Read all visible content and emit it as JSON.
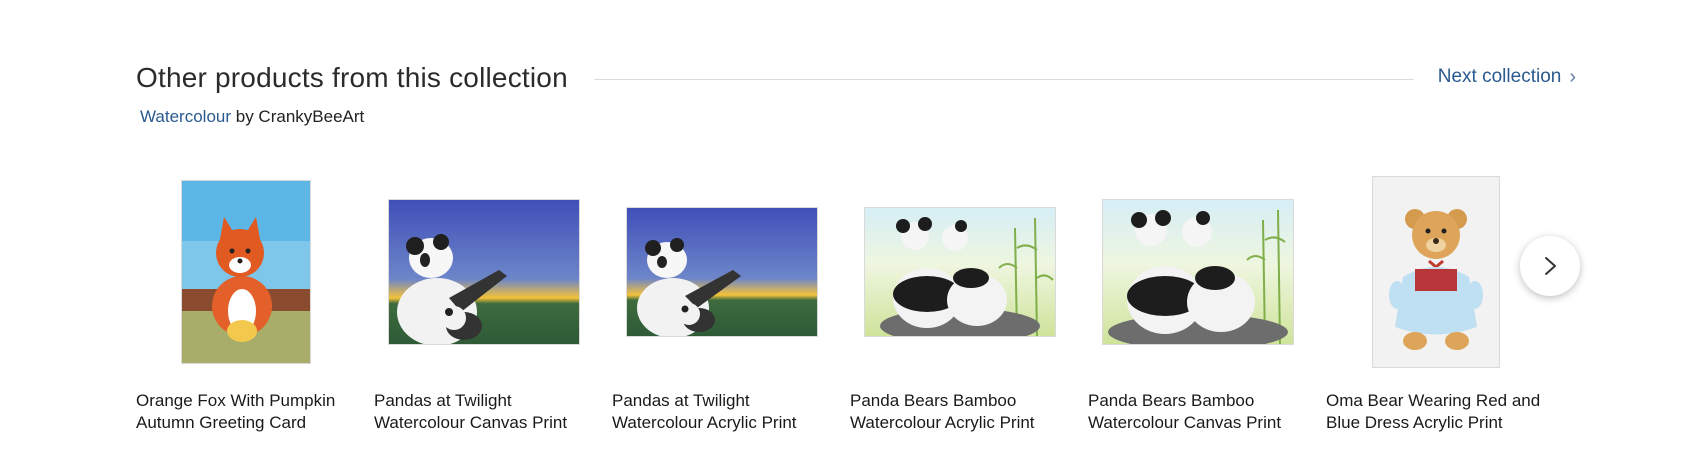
{
  "section": {
    "title": "Other products from this collection",
    "next_label": "Next collection",
    "collection_name": "Watercolour",
    "by_text": "by CrankyBeeArt"
  },
  "products": [
    {
      "line1": "Orange Fox With Pumpkin",
      "line2": "Autumn Greeting Card"
    },
    {
      "line1": "Pandas at Twilight",
      "line2": "Watercolour Canvas Print"
    },
    {
      "line1": "Pandas at Twilight",
      "line2": "Watercolour Acrylic Print"
    },
    {
      "line1": "Panda Bears Bamboo",
      "line2": "Watercolour Acrylic Print"
    },
    {
      "line1": "Panda Bears Bamboo",
      "line2": "Watercolour Canvas Print"
    },
    {
      "line1": "Oma Bear Wearing Red and",
      "line2": "Blue Dress Acrylic Print"
    }
  ],
  "icons": {
    "next_collection": "chevron-right-icon",
    "carousel_next": "arrow-right-icon"
  },
  "colors": {
    "link": "#2a5a8f",
    "text": "#222222",
    "rule": "#dcdcdc"
  }
}
